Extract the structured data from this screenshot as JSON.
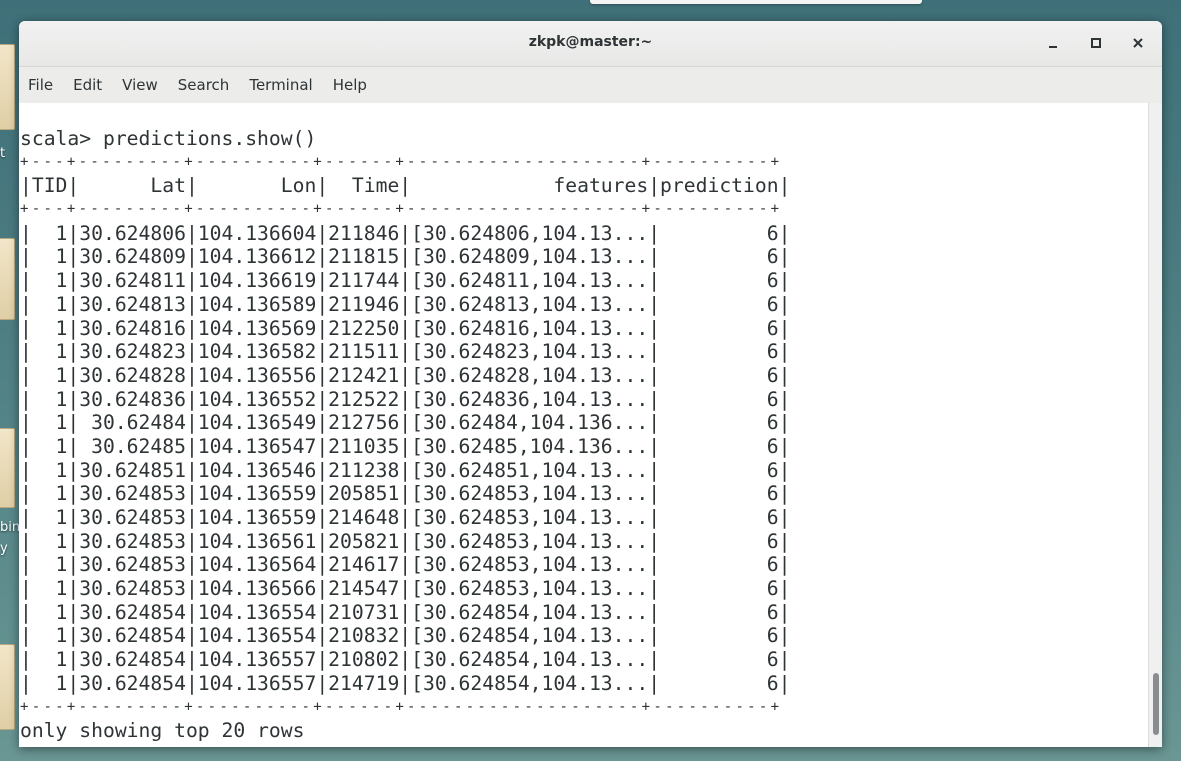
{
  "window": {
    "title": "zkpk@master:~",
    "minimize_label": "_",
    "maximize_label": "□",
    "close_label": "×"
  },
  "menubar": {
    "items": [
      "File",
      "Edit",
      "View",
      "Search",
      "Terminal",
      "Help"
    ]
  },
  "desktop": {
    "labels": [
      "t",
      "bin",
      "y"
    ]
  },
  "terminal": {
    "prompt": "scala> predictions.show()",
    "separator": "+---+---------+----------+------+--------------------+----------+",
    "header": "|TID|      Lat|       Lon|  Time|            features|prediction|",
    "rows": [
      "|  1|30.624806|104.136604|211846|[30.624806,104.13...|         6|",
      "|  1|30.624809|104.136612|211815|[30.624809,104.13...|         6|",
      "|  1|30.624811|104.136619|211744|[30.624811,104.13...|         6|",
      "|  1|30.624813|104.136589|211946|[30.624813,104.13...|         6|",
      "|  1|30.624816|104.136569|212250|[30.624816,104.13...|         6|",
      "|  1|30.624823|104.136582|211511|[30.624823,104.13...|         6|",
      "|  1|30.624828|104.136556|212421|[30.624828,104.13...|         6|",
      "|  1|30.624836|104.136552|212522|[30.624836,104.13...|         6|",
      "|  1| 30.62484|104.136549|212756|[30.62484,104.136...|         6|",
      "|  1| 30.62485|104.136547|211035|[30.62485,104.136...|         6|",
      "|  1|30.624851|104.136546|211238|[30.624851,104.13...|         6|",
      "|  1|30.624853|104.136559|205851|[30.624853,104.13...|         6|",
      "|  1|30.624853|104.136559|214648|[30.624853,104.13...|         6|",
      "|  1|30.624853|104.136561|205821|[30.624853,104.13...|         6|",
      "|  1|30.624853|104.136564|214617|[30.624853,104.13...|         6|",
      "|  1|30.624853|104.136566|214547|[30.624853,104.13...|         6|",
      "|  1|30.624854|104.136554|210731|[30.624854,104.13...|         6|",
      "|  1|30.624854|104.136554|210832|[30.624854,104.13...|         6|",
      "|  1|30.624854|104.136557|210802|[30.624854,104.13...|         6|",
      "|  1|30.624854|104.136557|214719|[30.624854,104.13...|         6|"
    ],
    "footer": "only showing top 20 rows"
  }
}
